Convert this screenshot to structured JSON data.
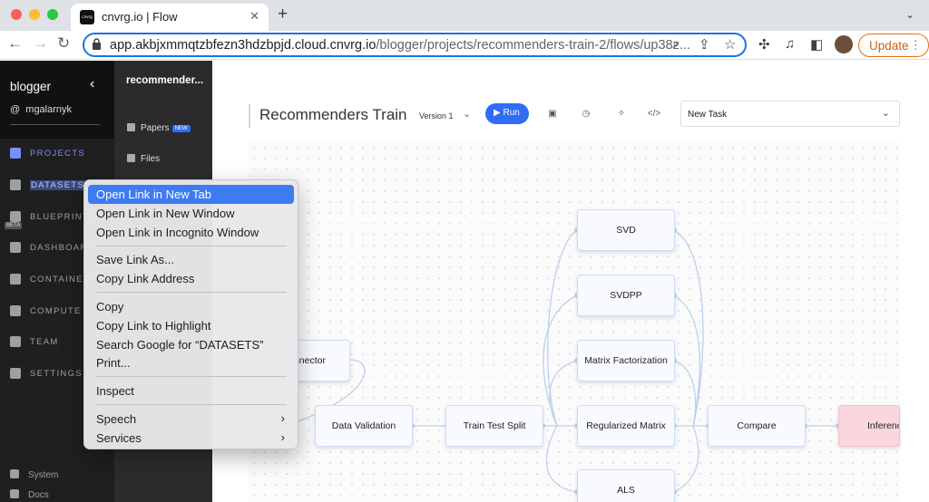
{
  "browser": {
    "tab_title": "cnvrg.io | Flow",
    "favicon_text": "cnvrg",
    "url_host": "app.akbjxmmqtzbfezn3hdzbpjd.cloud.cnvrg.io",
    "url_path": "/blogger/projects/recommenders-train-2/flows/up38z...",
    "update_label": "Update",
    "new_tab_symbol": "+",
    "close_symbol": "✕"
  },
  "sidebar": {
    "org": "blogger",
    "user": "mgalarnyk",
    "items": [
      {
        "label": "PROJECTS"
      },
      {
        "label": "DATASETS"
      },
      {
        "label": "BLUEPRINTS"
      },
      {
        "label": "DASHBOARDS"
      },
      {
        "label": "CONTAINERS"
      },
      {
        "label": "COMPUTE"
      },
      {
        "label": "TEAM"
      },
      {
        "label": "SETTINGS"
      }
    ],
    "beta_label": "BETA",
    "footer": [
      {
        "label": "System"
      },
      {
        "label": "Docs"
      }
    ]
  },
  "project_sidebar": {
    "name": "recommender...",
    "items": [
      {
        "label": "Papers"
      },
      {
        "label": "Files"
      }
    ],
    "new_badge": "NEW"
  },
  "flow": {
    "title": "Recommenders Train",
    "version": "Version 1",
    "run_label": "Run",
    "task_select": "New Task"
  },
  "nodes": [
    {
      "label": "SVD"
    },
    {
      "label": "SVDPP"
    },
    {
      "label": "Matrix Factorization"
    },
    {
      "label": "nnector"
    },
    {
      "label": "Data Validation"
    },
    {
      "label": "Train Test Split"
    },
    {
      "label": "Regularized Matrix"
    },
    {
      "label": "Compare"
    },
    {
      "label": "Inferenc"
    },
    {
      "label": "ALS"
    }
  ],
  "context_menu": {
    "items": [
      {
        "label": "Open Link in New Tab"
      },
      {
        "label": "Open Link in New Window"
      },
      {
        "label": "Open Link in Incognito Window"
      },
      {
        "label": "Save Link As..."
      },
      {
        "label": "Copy Link Address"
      },
      {
        "label": "Copy"
      },
      {
        "label": "Copy Link to Highlight"
      },
      {
        "label": "Search Google for “DATASETS”"
      },
      {
        "label": "Print..."
      },
      {
        "label": "Inspect"
      },
      {
        "label": "Speech"
      },
      {
        "label": "Services"
      }
    ]
  },
  "colors": {
    "accent": "#2f6df6",
    "context_highlight": "#3d7bf2",
    "sidebar_bg": "#1f1f1f",
    "node_pink": "#fbd6dd"
  }
}
